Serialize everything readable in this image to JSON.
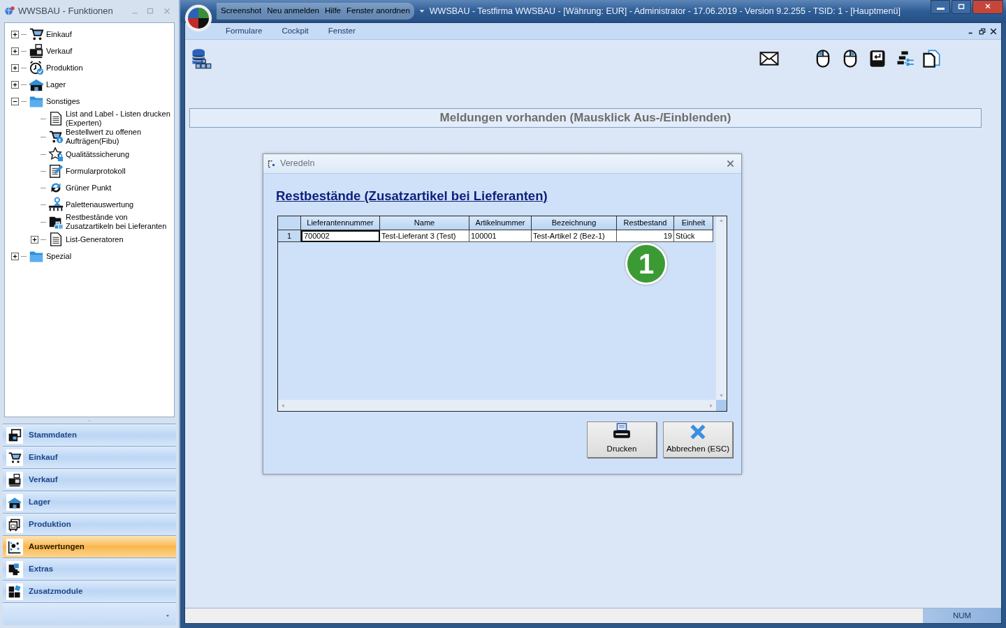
{
  "side_window": {
    "title": "WWSBAU - Funktionen"
  },
  "tree": [
    {
      "label": "Einkauf",
      "expanded": false
    },
    {
      "label": "Verkauf",
      "expanded": false
    },
    {
      "label": "Produktion",
      "expanded": false
    },
    {
      "label": "Lager",
      "expanded": false
    },
    {
      "label": "Sonstiges",
      "expanded": true,
      "children": [
        {
          "label": "List and Label - Listen drucken (Experten)"
        },
        {
          "label": "Bestellwert zu offenen Aufträgen(Fibu)"
        },
        {
          "label": "Qualitätssicherung"
        },
        {
          "label": "Formularprotokoll"
        },
        {
          "label": "Grüner Punkt"
        },
        {
          "label": "Palettenauswertung"
        },
        {
          "label": "Restbestände von Zusatzartikeln bei Lieferanten"
        },
        {
          "label": "List-Generatoren",
          "expanded": false
        }
      ]
    },
    {
      "label": "Spezial",
      "expanded": false
    }
  ],
  "nav": [
    {
      "label": "Stammdaten",
      "selected": false
    },
    {
      "label": "Einkauf",
      "selected": false
    },
    {
      "label": "Verkauf",
      "selected": false
    },
    {
      "label": "Lager",
      "selected": false
    },
    {
      "label": "Produktion",
      "selected": false
    },
    {
      "label": "Auswertungen",
      "selected": true
    },
    {
      "label": "Extras",
      "selected": false
    },
    {
      "label": "Zusatzmodule",
      "selected": false
    }
  ],
  "quick_access": [
    "Screenshot",
    "Neu anmelden",
    "Hilfe",
    "Fenster anordnen"
  ],
  "window": {
    "title": "WWSBAU - Testfirma WWSBAU - [Währung: EUR] - Administrator - 17.06.2019 - Version 9.2.255 - TSID: 1  - [Hauptmenü]"
  },
  "menu": [
    "Formulare",
    "Cockpit",
    "Fenster"
  ],
  "messages_bar": "Meldungen vorhanden  (Mausklick Aus-/Einblenden)",
  "dialog": {
    "title": "Veredeln",
    "heading": "Restbestände  (Zusatzartikel bei Lieferanten)",
    "columns": [
      "Lieferantennummer",
      "Name",
      "Artikelnummer",
      "Bezeichnung",
      "Restbestand",
      "Einheit"
    ],
    "rows": [
      {
        "number": "1",
        "cells": [
          {
            "text": "700002",
            "selected": true
          },
          {
            "text": "Test-Lieferant 3  (Test)",
            "selected": false
          },
          {
            "text": "100001",
            "selected": false
          },
          {
            "text": "Test-Artikel 2  (Bez-1)",
            "selected": false
          },
          {
            "text": "19",
            "selected": false
          },
          {
            "text": "Stück",
            "selected": false
          }
        ]
      }
    ],
    "buttons": [
      "Drucken",
      "Abbrechen (ESC)"
    ]
  },
  "callout": "1",
  "status_bar": {
    "indicator": "NUM"
  }
}
